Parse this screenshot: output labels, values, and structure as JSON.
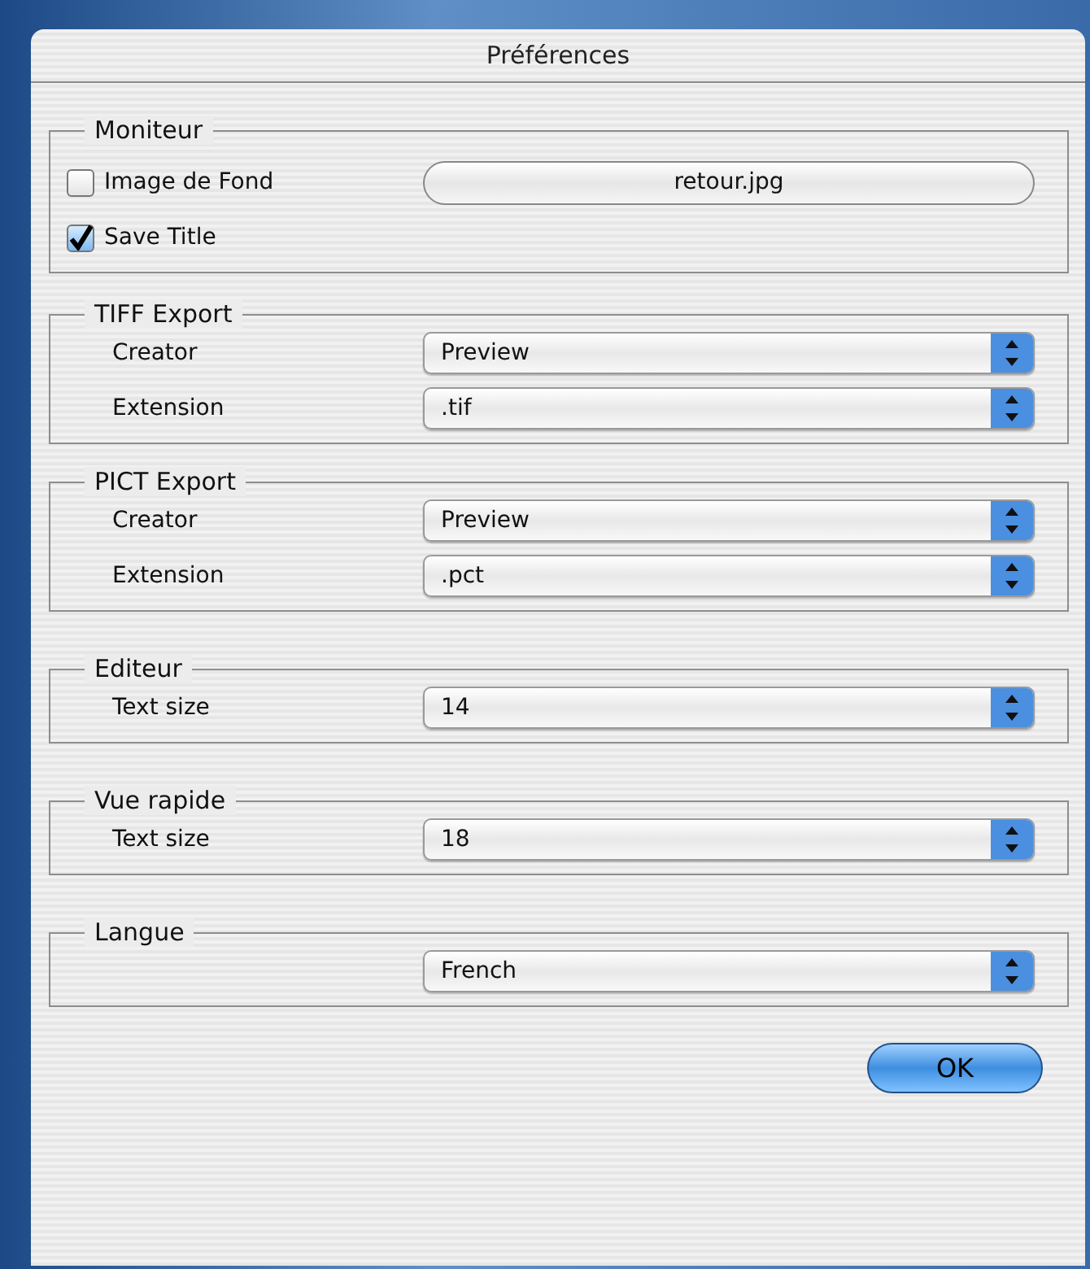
{
  "window": {
    "title": "Préférences"
  },
  "groups": [
    {
      "title": "Moniteur",
      "rows": [
        {
          "kind": "checkbox",
          "label": "Image de Fond",
          "checked": false,
          "button": "retour.jpg"
        },
        {
          "kind": "checkbox",
          "label": "Save Title",
          "checked": true
        }
      ]
    },
    {
      "title": "TIFF Export",
      "rows": [
        {
          "kind": "popup",
          "label": "Creator",
          "value": "Preview"
        },
        {
          "kind": "popup",
          "label": "Extension",
          "value": ".tif"
        }
      ]
    },
    {
      "title": "PICT Export",
      "rows": [
        {
          "kind": "popup",
          "label": "Creator",
          "value": "Preview"
        },
        {
          "kind": "popup",
          "label": "Extension",
          "value": ".pct"
        }
      ]
    },
    {
      "title": "Editeur",
      "rows": [
        {
          "kind": "popup",
          "label": "Text size",
          "value": "14"
        }
      ]
    },
    {
      "title": "Vue rapide",
      "rows": [
        {
          "kind": "popup",
          "label": "Text size",
          "value": "18"
        }
      ]
    },
    {
      "title": "Langue",
      "rows": [
        {
          "kind": "popup",
          "value": "French"
        }
      ]
    }
  ],
  "ok_button": "OK"
}
